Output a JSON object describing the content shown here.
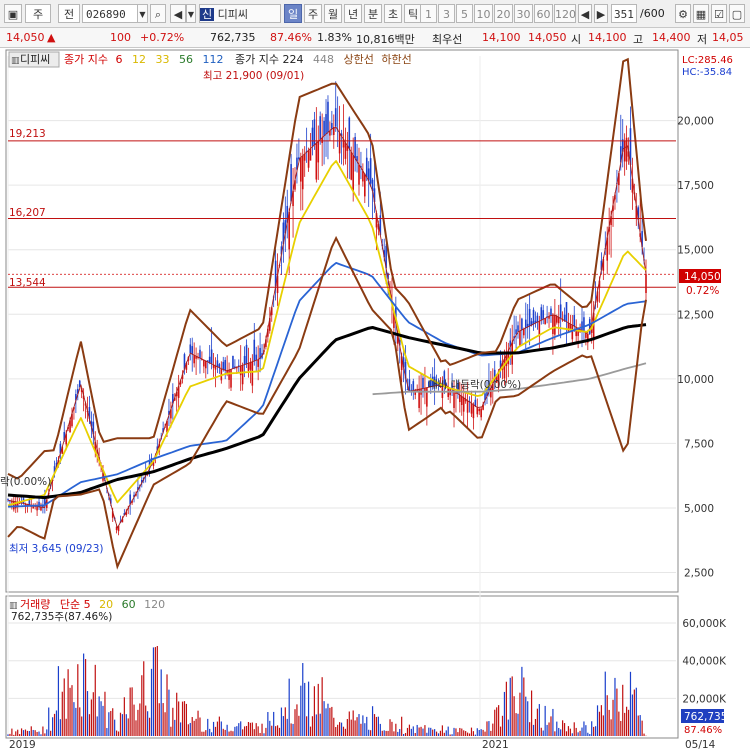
{
  "toolbar": {
    "market_btn": "주",
    "prev_btn": "전",
    "code": "026890",
    "name_prefix": "신",
    "name": "디피씨",
    "period_tabs": [
      "일",
      "주",
      "월",
      "년",
      "분",
      "초",
      "틱"
    ],
    "period_selected": "일",
    "numbers": [
      "1",
      "3",
      "5",
      "10",
      "20",
      "30",
      "60",
      "120"
    ],
    "count": "351",
    "count_total": "/600"
  },
  "quote": {
    "price": "14,050",
    "change_arrow": "▲",
    "change": "100",
    "change_pct": "+0.72%",
    "volume": "762,735",
    "vol_ratio": "87.46%",
    "turnover": "1.83%",
    "amount": "10,816백만",
    "best_sell_label": "최우선",
    "best_sell": "14,100",
    "best_buy": "14,050",
    "open_label": "시",
    "open": "14,100",
    "high_label": "고",
    "high": "14,400",
    "low_label": "저",
    "low": "14,05"
  },
  "price_panel": {
    "tab_label": "디피씨",
    "legend_prefix": "종가 지수",
    "legend_ma": [
      "6",
      "12",
      "33",
      "56",
      "112"
    ],
    "legend_ma_colors": [
      "#d00000",
      "#d9b800",
      "#3a9e00",
      "#2a7a2a",
      "#2060c0"
    ],
    "legend_envelope": "종가 지수 224",
    "legend_448": "448",
    "legend_upper": "상한선",
    "legend_lower": "하한선",
    "lc": "LC:285.46",
    "hc": "HC:-35.84",
    "high_annot": "최고 21,900 (09/01)",
    "low_annot": "최저 3,645 (09/23)",
    "hline_labels": [
      "19,213",
      "16,207",
      "13,544"
    ],
    "last_price_label": "14,050",
    "last_pct_label": "0.72%",
    "mid_annot": "대비 대등락(0.00%)",
    "left_annot": "락(0.00%)"
  },
  "volume_panel": {
    "legend_prefix": "거래량",
    "legend_ma_label": "단순 5",
    "legend_ma": [
      "20",
      "60",
      "120"
    ],
    "legend_ma_colors": [
      "#d9b800",
      "#2a7a2a",
      "#888888"
    ],
    "sub": "762,735주(87.46%)",
    "last_label": "762,735",
    "last_pct": "87.46%"
  },
  "date_labels": [
    "2019",
    "2021",
    "05/14"
  ],
  "chart_data": {
    "type": "line",
    "title": "디피씨 (026890) 일봉",
    "price_axis": {
      "ticks": [
        2500,
        5000,
        7500,
        10000,
        12500,
        15000,
        17500,
        20000
      ],
      "ylim": [
        1900,
        22500
      ]
    },
    "volume_axis": {
      "ticks": [
        20000,
        40000,
        60000
      ],
      "unit": "K",
      "ylim": [
        0,
        68000
      ]
    },
    "horizontal_lines": [
      19213,
      16207,
      13544
    ],
    "last_price": 14050,
    "period_high": 21900,
    "period_low": 3645,
    "x": [
      0,
      20,
      40,
      60,
      80,
      100,
      120,
      140,
      160,
      180,
      200,
      220,
      240,
      260,
      280,
      300,
      320,
      340,
      351
    ],
    "series": [
      {
        "name": "종가",
        "color": "#d00000",
        "values": [
          5300,
          5000,
          9800,
          4200,
          6800,
          11000,
          10300,
          10800,
          18500,
          19800,
          17500,
          9500,
          9800,
          8800,
          11800,
          12500,
          11700,
          19500,
          14050
        ]
      },
      {
        "name": "12",
        "color": "#e8d000",
        "values": [
          5100,
          5500,
          8500,
          5200,
          6800,
          9700,
          10200,
          10300,
          16000,
          18500,
          16000,
          10500,
          9700,
          9300,
          11200,
          12000,
          11800,
          15000,
          14200
        ]
      },
      {
        "name": "112",
        "color": "#2a64d4",
        "values": [
          5050,
          5100,
          6000,
          6300,
          6900,
          7400,
          7600,
          8900,
          13000,
          14500,
          14000,
          12200,
          11400,
          10900,
          11000,
          11600,
          12100,
          12900,
          13000
        ]
      },
      {
        "name": "224",
        "color": "#000000",
        "values": [
          5500,
          5400,
          5600,
          6100,
          6400,
          6900,
          7300,
          7800,
          10000,
          11500,
          12000,
          11600,
          11300,
          11000,
          11000,
          11200,
          11500,
          12000,
          12100
        ]
      },
      {
        "name": "448",
        "color": "#9a9a9a",
        "values": [
          null,
          null,
          null,
          null,
          null,
          null,
          null,
          null,
          null,
          null,
          9400,
          9500,
          9500,
          9500,
          9600,
          9800,
          10000,
          10400,
          10600
        ]
      }
    ],
    "volume_series": {
      "name": "거래량",
      "color": "#c01010",
      "last": 762735,
      "values": [
        3000,
        6000,
        55000,
        12000,
        50000,
        14000,
        9000,
        8000,
        40000,
        15000,
        12000,
        6000,
        5000,
        4000,
        40000,
        9000,
        6000,
        45000,
        763
      ]
    }
  }
}
